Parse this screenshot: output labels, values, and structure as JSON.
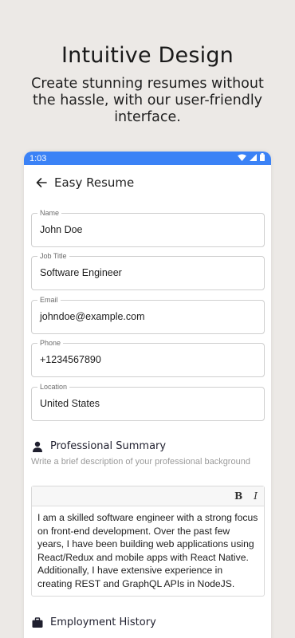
{
  "promo": {
    "title": "Intuitive Design",
    "subtitle": "Create stunning resumes without the hassle, with our user-friendly interface."
  },
  "status_bar": {
    "time": "1:03"
  },
  "app_bar": {
    "title": "Easy Resume"
  },
  "fields": [
    {
      "label": "Name",
      "value": "John Doe"
    },
    {
      "label": "Job Title",
      "value": "Software Engineer"
    },
    {
      "label": "Email",
      "value": "johndoe@example.com"
    },
    {
      "label": "Phone",
      "value": "+1234567890"
    },
    {
      "label": "Location",
      "value": "United States"
    }
  ],
  "summary": {
    "title": "Professional Summary",
    "description": "Write a brief description of your professional background",
    "toolbar": {
      "bold": "B",
      "italic": "I"
    },
    "text": "I am a skilled software engineer with a strong focus on front-end development. Over the past few years, I have been building web applications using React/Redux and mobile apps with React Native. Additionally, I have extensive experience in creating REST and GraphQL APIs in NodeJS."
  },
  "employment": {
    "title": "Employment History"
  },
  "colors": {
    "accent": "#3b82f6",
    "background": "#ece9e6"
  },
  "icons": [
    "back-arrow-icon",
    "wifi-icon",
    "signal-icon",
    "battery-icon",
    "person-icon",
    "briefcase-icon"
  ]
}
